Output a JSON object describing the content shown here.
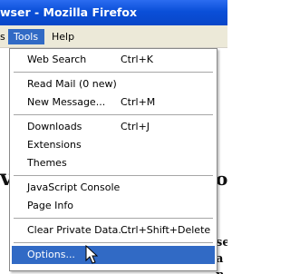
{
  "window": {
    "title": "wser - Mozilla Firefox"
  },
  "menubar": {
    "items": [
      {
        "label": "s"
      },
      {
        "label": "Tools"
      },
      {
        "label": "Help"
      }
    ]
  },
  "background_page": {
    "left_glyph": "v",
    "right_glyphs": [
      "o",
      "se",
      "a",
      "n"
    ]
  },
  "tools_menu": {
    "items": [
      {
        "label": "Web Search",
        "shortcut": "Ctrl+K"
      },
      {
        "label": "Read Mail (0 new)",
        "shortcut": ""
      },
      {
        "label": "New Message...",
        "shortcut": "Ctrl+M"
      },
      {
        "label": "Downloads",
        "shortcut": "Ctrl+J"
      },
      {
        "label": "Extensions",
        "shortcut": ""
      },
      {
        "label": "Themes",
        "shortcut": ""
      },
      {
        "label": "JavaScript Console",
        "shortcut": ""
      },
      {
        "label": "Page Info",
        "shortcut": ""
      },
      {
        "label": "Clear Private Data...",
        "shortcut": "Ctrl+Shift+Delete"
      },
      {
        "label": "Options...",
        "shortcut": "",
        "selected": true
      }
    ]
  },
  "colors": {
    "titlebar": "#0a4fd8",
    "menubar_bg": "#ece9d8",
    "highlight": "#316ac5"
  }
}
